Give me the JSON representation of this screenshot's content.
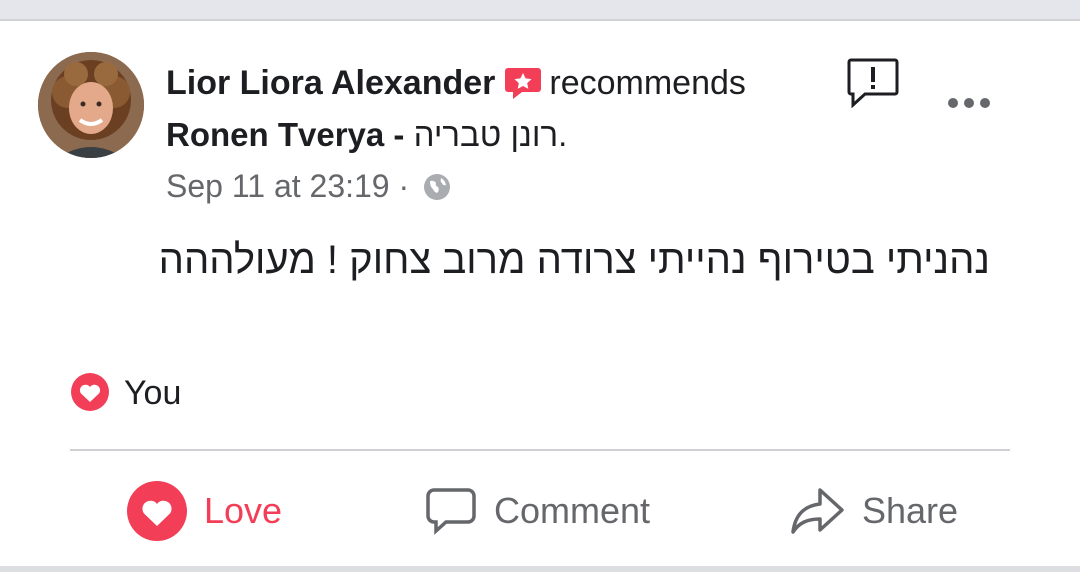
{
  "post": {
    "author": "Lior Liora Alexander",
    "recommends_label": "recommends",
    "page_name": "Ronen Tverya - ",
    "page_name_hebrew": "רונן טבריה.",
    "timestamp": "Sep 11 at 23:19",
    "separator": " · ",
    "body": "נהניתי בטירוף נהייתי צרודה מרוב צחוק ! מעולההה"
  },
  "reactions": {
    "label": "You"
  },
  "actions": {
    "love": "Love",
    "comment": "Comment",
    "share": "Share"
  },
  "colors": {
    "love_accent": "#f33e58",
    "secondary_text": "#65676b",
    "primary_text": "#1c1e21"
  },
  "icons": {
    "recommend": "recommend-star-icon",
    "privacy": "globe-icon",
    "report": "report-icon",
    "more": "more-dots-icon",
    "reaction": "love-reaction-icon",
    "love": "love-icon",
    "comment": "comment-icon",
    "share": "share-icon"
  }
}
